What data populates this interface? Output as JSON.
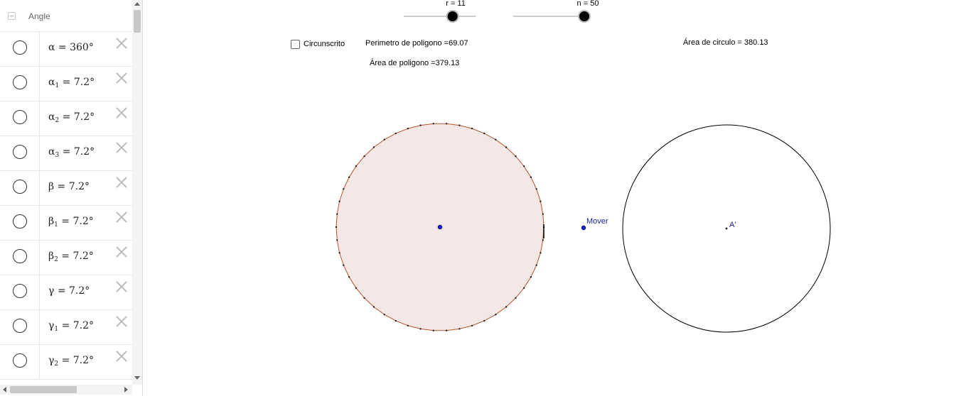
{
  "algebra": {
    "group_title": "Angle",
    "rows": [
      {
        "sym": "α",
        "sub": "",
        "value": "= 360°"
      },
      {
        "sym": "α",
        "sub": "1",
        "value": "= 7.2°"
      },
      {
        "sym": "α",
        "sub": "2",
        "value": "= 7.2°"
      },
      {
        "sym": "α",
        "sub": "3",
        "value": "= 7.2°"
      },
      {
        "sym": "β",
        "sub": "",
        "value": "= 7.2°"
      },
      {
        "sym": "β",
        "sub": "1",
        "value": "= 7.2°"
      },
      {
        "sym": "β",
        "sub": "2",
        "value": "= 7.2°"
      },
      {
        "sym": "γ",
        "sub": "",
        "value": "= 7.2°"
      },
      {
        "sym": "γ",
        "sub": "1",
        "value": "= 7.2°"
      },
      {
        "sym": "γ",
        "sub": "2",
        "value": "= 7.2°"
      }
    ]
  },
  "graphics": {
    "slider_r": {
      "label": "r = 11",
      "value_fraction": 0.68
    },
    "slider_n": {
      "label": "n = 50",
      "value_fraction": 1.0
    },
    "checkbox_label": "Circunscrito",
    "checkbox_checked": false,
    "perimetro_text": "Perimetro de poligono =69.07",
    "area_poligono_text": "Área de poligono =379.13",
    "area_circulo_text": "Área de circulo = 380.13",
    "polygon_sides": 50,
    "mover_label": "Mover",
    "point_a_label": "A'",
    "colors": {
      "polygon_fill": "#f3e8e5",
      "polygon_edge": "#b5562f",
      "point_blue": "#1c1ccc",
      "label_blue": "#1c1c99"
    }
  }
}
